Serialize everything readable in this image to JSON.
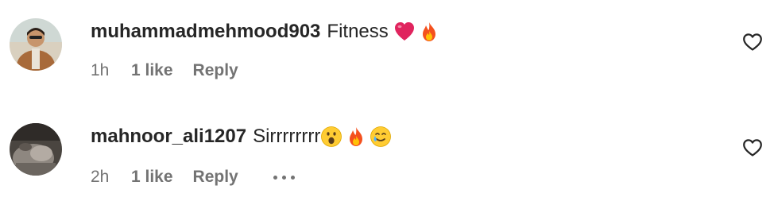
{
  "comments": [
    {
      "username": "muhammadmehmood903",
      "text": "Fitness",
      "emojis": [
        "red-heart",
        "fire"
      ],
      "time": "1h",
      "likes": "1 like",
      "reply": "Reply",
      "has_more_options": false
    },
    {
      "username": "mahnoor_ali1207",
      "text": "Sirrrrrrrr",
      "emojis": [
        "face-with-open-mouth",
        "fire",
        "smiling-face-with-tear"
      ],
      "time": "2h",
      "likes": "1 like",
      "reply": "Reply",
      "has_more_options": true
    }
  ],
  "colors": {
    "primary_text": "#262626",
    "secondary_text": "#737373",
    "background": "#ffffff"
  },
  "icons": {
    "like": "heart-outline-icon",
    "more": "ellipsis-icon"
  }
}
